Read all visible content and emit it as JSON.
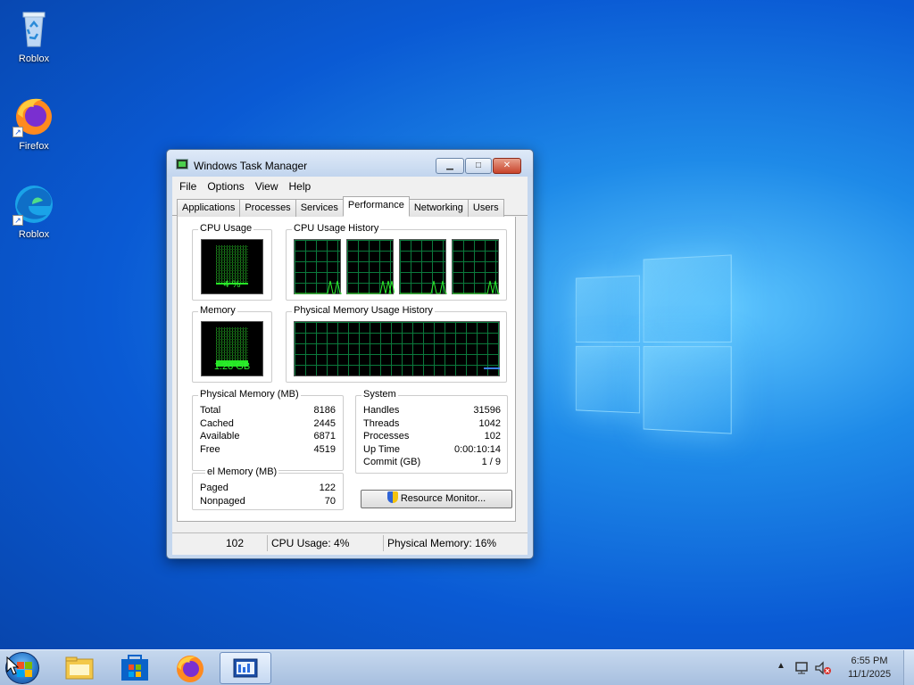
{
  "desktop": {
    "icons": [
      {
        "label": "Roblox",
        "icon": "recycle-bin-icon"
      },
      {
        "label": "Firefox",
        "icon": "firefox-icon"
      },
      {
        "label": "Roblox",
        "icon": "edge-icon"
      }
    ]
  },
  "window": {
    "title": "Windows Task Manager",
    "buttons": {
      "minimize": "▁",
      "maximize": "□",
      "close": "✕"
    },
    "menu": [
      "File",
      "Options",
      "View",
      "Help"
    ],
    "tabs": [
      "Applications",
      "Processes",
      "Services",
      "Performance",
      "Networking",
      "Users"
    ],
    "active_tab": "Performance",
    "performance": {
      "cpu_usage": {
        "label": "CPU Usage",
        "value": "4 %",
        "percent": 4
      },
      "cpu_history": {
        "label": "CPU Usage History",
        "cores": 4
      },
      "memory": {
        "label": "Memory",
        "value": "1.28 GB",
        "percent": 16
      },
      "memory_history": {
        "label": "Physical Memory Usage History"
      },
      "physical_memory": {
        "label": "Physical Memory (MB)",
        "rows": [
          {
            "k": "Total",
            "v": "8186"
          },
          {
            "k": "Cached",
            "v": "2445"
          },
          {
            "k": "Available",
            "v": "6871"
          },
          {
            "k": "Free",
            "v": "4519"
          }
        ]
      },
      "kernel_memory": {
        "label": "el Memory (MB)",
        "rows": [
          {
            "k": "Paged",
            "v": "122"
          },
          {
            "k": "Nonpaged",
            "v": "70"
          }
        ]
      },
      "system": {
        "label": "System",
        "rows": [
          {
            "k": "Handles",
            "v": "31596"
          },
          {
            "k": "Threads",
            "v": "1042"
          },
          {
            "k": "Processes",
            "v": "102"
          },
          {
            "k": "Up Time",
            "v": "0:00:10:14"
          },
          {
            "k": "Commit (GB)",
            "v": "1 / 9"
          }
        ]
      },
      "resource_monitor_button": "Resource Monitor..."
    },
    "status": {
      "processes": "102",
      "cpu": "CPU Usage: 4%",
      "memory": "Physical Memory: 16%"
    }
  },
  "taskbar": {
    "items": [
      "file-explorer-icon",
      "store-icon",
      "firefox-icon",
      "task-manager-icon"
    ],
    "clock": {
      "time": "6:55 PM",
      "date": "11/1/2025"
    }
  }
}
